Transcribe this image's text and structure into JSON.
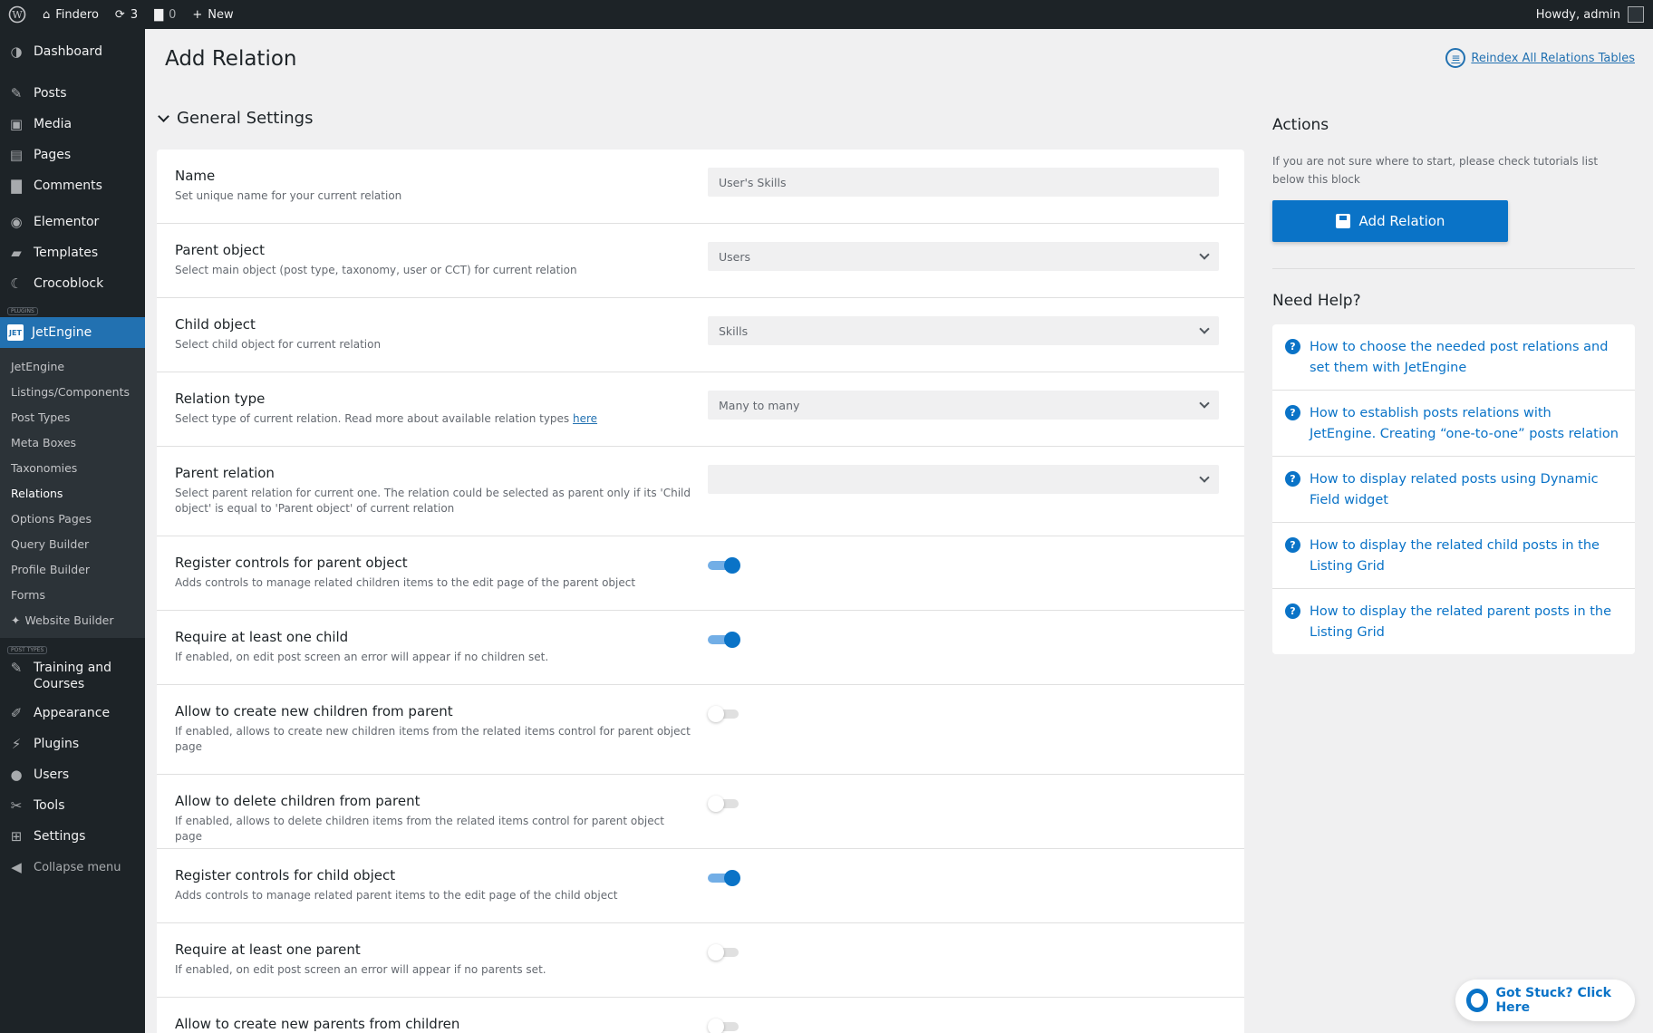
{
  "adminbar": {
    "site_name": "Findero",
    "updates": "3",
    "comments": "0",
    "new_label": "New",
    "howdy": "Howdy, admin"
  },
  "sidebar": {
    "items_top": [
      {
        "label": "Dashboard",
        "icon": "dashboard-icon"
      },
      {
        "label": "Posts",
        "icon": "pin-icon"
      },
      {
        "label": "Media",
        "icon": "media-icon"
      },
      {
        "label": "Pages",
        "icon": "pages-icon"
      },
      {
        "label": "Comments",
        "icon": "comments-icon"
      },
      {
        "label": "Elementor",
        "icon": "elementor-icon"
      },
      {
        "label": "Templates",
        "icon": "folder-icon"
      },
      {
        "label": "Crocoblock",
        "icon": "crocoblock-icon"
      }
    ],
    "plugins_sep": "PLUGINS",
    "jetengine": "JetEngine",
    "submenu": [
      "JetEngine",
      "Listings/Components",
      "Post Types",
      "Meta Boxes",
      "Taxonomies",
      "Relations",
      "Options Pages",
      "Query Builder",
      "Profile Builder",
      "Forms",
      "Website Builder"
    ],
    "post_types_sep": "POST TYPES",
    "training": "Training and Courses",
    "items_bottom": [
      {
        "label": "Appearance",
        "icon": "brush-icon"
      },
      {
        "label": "Plugins",
        "icon": "plugin-icon"
      },
      {
        "label": "Users",
        "icon": "users-icon"
      },
      {
        "label": "Tools",
        "icon": "wrench-icon"
      },
      {
        "label": "Settings",
        "icon": "settings-icon"
      },
      {
        "label": "Collapse menu",
        "icon": "collapse-icon"
      }
    ]
  },
  "header": {
    "title": "Add Relation",
    "reindex": "Reindex All Relations Tables"
  },
  "section": {
    "title": "General Settings"
  },
  "fields": {
    "name": {
      "title": "Name",
      "desc": "Set unique name for your current relation",
      "value": "User's Skills"
    },
    "parent_object": {
      "title": "Parent object",
      "desc": "Select main object (post type, taxonomy, user or CCT) for current relation",
      "value": "Users"
    },
    "child_object": {
      "title": "Child object",
      "desc": "Select child object for current relation",
      "value": "Skills"
    },
    "relation_type": {
      "title": "Relation type",
      "desc": "Select type of current relation. Read more about available relation types",
      "link": "here",
      "value": "Many to many"
    },
    "parent_relation": {
      "title": "Parent relation",
      "desc": "Select parent relation for current one. The relation could be selected as parent only if its 'Child object' is equal to 'Parent object' of current relation",
      "value": ""
    }
  },
  "toggles": [
    {
      "title": "Register controls for parent object",
      "desc": "Adds controls to manage related children items to the edit page of the parent object",
      "on": true
    },
    {
      "title": "Require at least one child",
      "desc": "If enabled, on edit post screen an error will appear if no children set.",
      "on": true
    },
    {
      "title": "Allow to create new children from parent",
      "desc": "If enabled, allows to create new children items from the related items control for parent object page",
      "on": false
    },
    {
      "title": "Allow to delete children from parent",
      "desc": "If enabled, allows to delete children items from the related items control for parent object page",
      "on": false
    },
    {
      "title": "Register controls for child object",
      "desc": "Adds controls to manage related parent items to the edit page of the child object",
      "on": true
    },
    {
      "title": "Require at least one parent",
      "desc": "If enabled, on edit post screen an error will appear if no parents set.",
      "on": false
    },
    {
      "title": "Allow to create new parents from children",
      "desc": "",
      "on": false
    }
  ],
  "actions": {
    "title": "Actions",
    "desc": "If you are not sure where to start, please check tutorials list below this block",
    "button": "Add Relation"
  },
  "help": {
    "title": "Need Help?",
    "links": [
      "How to choose the needed post relations and set them with JetEngine",
      "How to establish posts relations with JetEngine. Creating “one-to-one” posts relation",
      "How to display related posts using Dynamic Field widget",
      "How to display the related child posts in the Listing Grid",
      "How to display the related parent posts in the Listing Grid"
    ]
  },
  "stuck": "Got Stuck? Click Here",
  "colors": {
    "accent": "#0a73c7",
    "menu_active": "#2271b1",
    "adminbar": "#1d2327"
  }
}
